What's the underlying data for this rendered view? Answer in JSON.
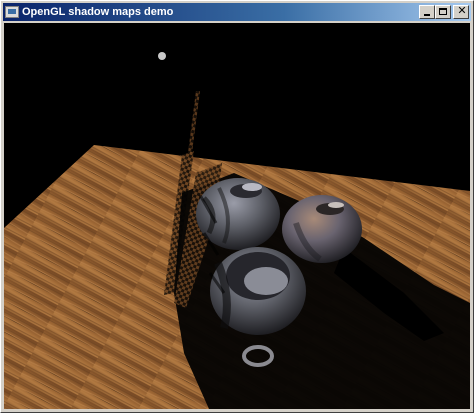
{
  "window": {
    "title": "OpenGL shadow maps demo",
    "icon": "opengl-app-icon",
    "buttons": {
      "minimize": "minimize-icon",
      "maximize": "maximize-icon",
      "close": "close-icon"
    }
  },
  "scene": {
    "background": "#000000",
    "floor_color": "#a8743f",
    "floor_dark": "#6e4522",
    "light_color": "#c8c8c8",
    "object_color": "#7a7c88"
  }
}
